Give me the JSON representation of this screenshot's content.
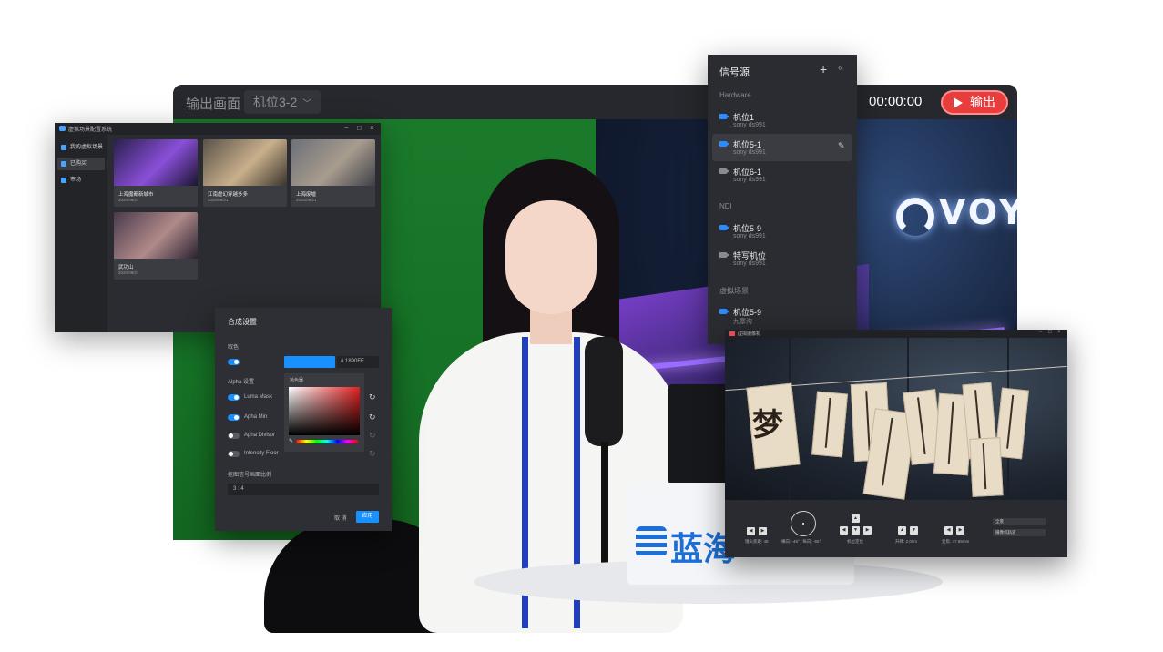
{
  "main_window": {
    "title": "输出画面",
    "camera_selected": "机位3-2",
    "timer": "00:00:00",
    "output_button": "输出",
    "backdrop_logo_text": "VOYAGE",
    "desk_board_text": "蓝海"
  },
  "scene_window": {
    "title": "虚拟场景配置系统",
    "sidebar": [
      {
        "label": "我的虚拟场景",
        "active": false
      },
      {
        "label": "已购买",
        "active": true
      },
      {
        "label": "市场",
        "active": false
      }
    ],
    "scenes": [
      {
        "name": "上海魔都新城市",
        "date": "2020/09/21"
      },
      {
        "name": "江南虚幻穿越多多",
        "date": "2020/09/21"
      },
      {
        "name": "上海废墟",
        "date": "2020/09/21"
      },
      {
        "name": "武功山",
        "date": "2020/09/21"
      }
    ]
  },
  "composite_panel": {
    "title": "合成设置",
    "key_color_label": "取色",
    "color_hex": "# 1890FF",
    "picker_label": "拾色器",
    "alpha_label": "Alpha 设置",
    "options": [
      {
        "label": "Luma Mask",
        "on": true
      },
      {
        "label": "Apha Min",
        "on": true
      },
      {
        "label": "Apha Divisor",
        "on": false
      },
      {
        "label": "Intensity Floor",
        "on": false
      }
    ],
    "ratio_label": "抠图信号画面比例",
    "ratio_value": "3 : 4",
    "cancel_button": "取 消",
    "apply_button": "应用",
    "accent_color": "#1890FF"
  },
  "signal_panel": {
    "title": "信号源",
    "sections": [
      {
        "name": "Hardware",
        "items": [
          {
            "name": "机位1",
            "device": "sony ds991",
            "active": false
          },
          {
            "name": "机位5-1",
            "device": "sony ds991",
            "active": true
          },
          {
            "name": "机位6-1",
            "device": "sony ds991",
            "active": false
          }
        ]
      },
      {
        "name": "NDI",
        "items": [
          {
            "name": "机位5-9",
            "device": "sony ds991",
            "active": false
          },
          {
            "name": "特写机位",
            "device": "sony ds991",
            "active": false
          }
        ]
      },
      {
        "name": "虚拟场景",
        "items": [
          {
            "name": "机位5-9",
            "device": "九寨沟",
            "active": false
          }
        ]
      }
    ]
  },
  "ptz_window": {
    "title": "虚拟摄像机",
    "calligraphy_char": "梦",
    "controls": [
      {
        "label": "镜头焦距: 48"
      },
      {
        "label": "横向: -45° / 纵向: -65°"
      },
      {
        "label": "机位定位"
      },
      {
        "label": "升降: 2.00m"
      },
      {
        "label": "变焦: 47.89mm"
      }
    ],
    "dropdowns": [
      "全景",
      "摄像机轨道"
    ]
  }
}
